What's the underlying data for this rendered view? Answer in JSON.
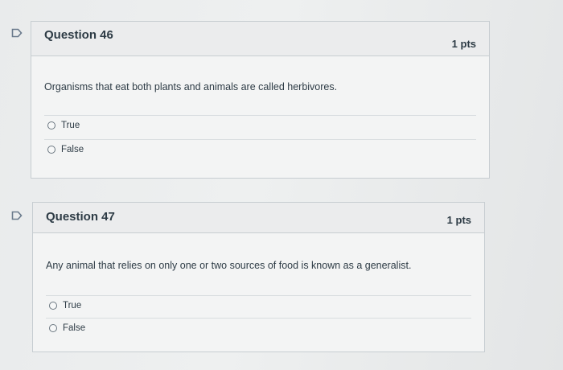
{
  "questions": [
    {
      "title": "Question 46",
      "points": "1 pts",
      "text": "Organisms that eat both plants and animals are called herbivores.",
      "answers": [
        "True",
        "False"
      ]
    },
    {
      "title": "Question 47",
      "points": "1 pts",
      "text": "Any animal that relies on only one or two sources of food is known as a generalist.",
      "answers": [
        "True",
        "False"
      ]
    }
  ],
  "colors": {
    "flag": "#6a7a8c",
    "border": "#c7cdd1",
    "text": "#2d3b45"
  }
}
